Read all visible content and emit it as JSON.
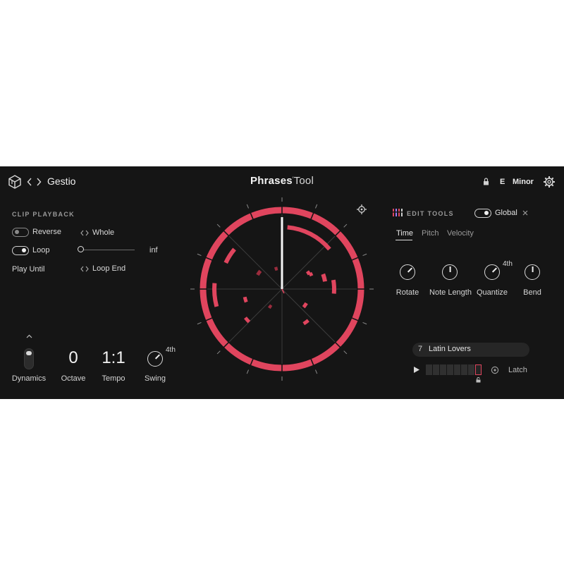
{
  "header": {
    "plugin_name": "Gestio",
    "brand_bold": "Phrases",
    "brand_light": "Tool",
    "key_root": "E",
    "key_scale": "Minor",
    "icons": [
      "cube-logo-icon",
      "chevron-left-icon",
      "chevron-right-icon",
      "lock-icon",
      "gear-icon"
    ]
  },
  "clip_playback": {
    "title": "CLIP PLAYBACK",
    "reverse_label": "Reverse",
    "reverse_on": false,
    "loop_label": "Loop",
    "loop_on": true,
    "play_until_label": "Play Until",
    "reverse_value": "Whole",
    "loop_value_end": "inf",
    "play_until_value": "Loop End"
  },
  "bottom_controls": {
    "dynamics_label": "Dynamics",
    "octave_value": "0",
    "octave_label": "Octave",
    "tempo_value": "1:1",
    "tempo_label": "Tempo",
    "swing_label": "Swing",
    "swing_value": "4th"
  },
  "edit_tools": {
    "title": "EDIT TOOLS",
    "global_label": "Global",
    "global_on": true,
    "tabs": [
      "Time",
      "Pitch",
      "Velocity"
    ],
    "active_tab": "Time",
    "knobs": [
      {
        "label": "Rotate",
        "value": ""
      },
      {
        "label": "Note Length",
        "value": ""
      },
      {
        "label": "Quantize",
        "value": "4th"
      },
      {
        "label": "Bend",
        "value": ""
      }
    ]
  },
  "preset": {
    "number": "7",
    "name": "Latin Lovers"
  },
  "transport": {
    "latch_label": "Latch",
    "steps": 8,
    "active_step": 8
  },
  "colors": {
    "background": "#151515",
    "accent": "#e0455e",
    "accent_dim": "#9a2c3d",
    "text": "#e6e6e6",
    "muted": "#8d8d8d"
  }
}
